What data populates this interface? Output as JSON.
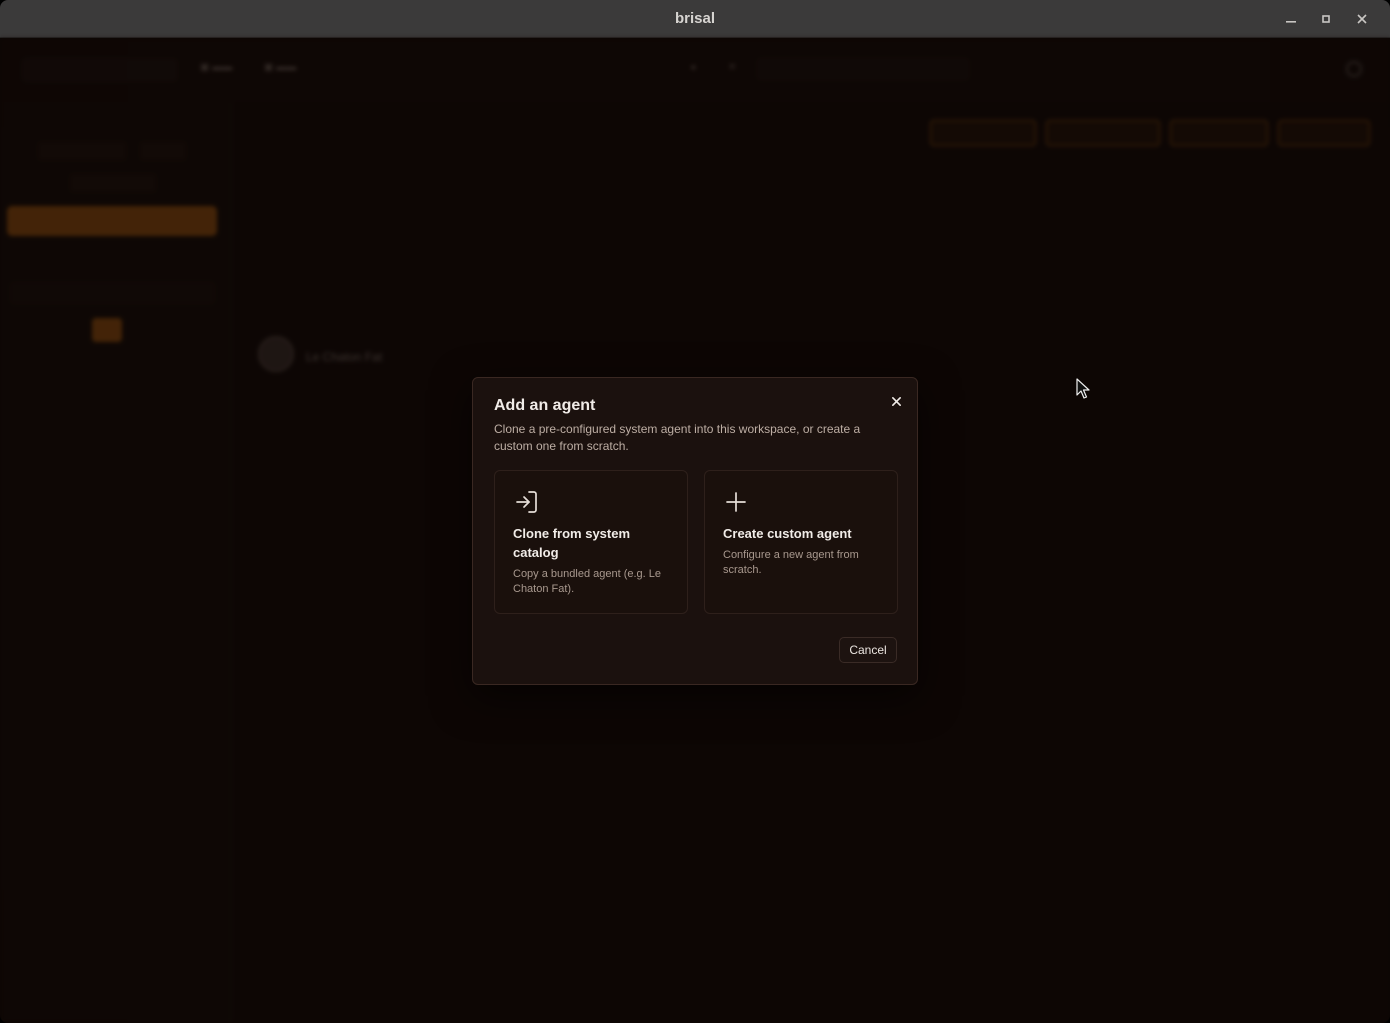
{
  "window": {
    "title": "brisal",
    "controls": [
      "minimize-icon",
      "maximize-icon",
      "close-icon"
    ]
  },
  "modal": {
    "title": "Add an agent",
    "description": "Clone a pre-configured system agent into this workspace, or create a custom one from scratch.",
    "options": [
      {
        "icon": "login-arrow-icon",
        "title": "Clone from system catalog",
        "description": "Copy a bundled agent (e.g. Le Chaton Fat)."
      },
      {
        "icon": "plus-icon",
        "title": "Create custom agent",
        "description": "Configure a new agent from scratch."
      }
    ],
    "cancel_label": "Cancel",
    "close_icon": "close-icon"
  },
  "background": {
    "agent_name": "Le Chaton Fat",
    "accent_color": "#c26a12"
  }
}
